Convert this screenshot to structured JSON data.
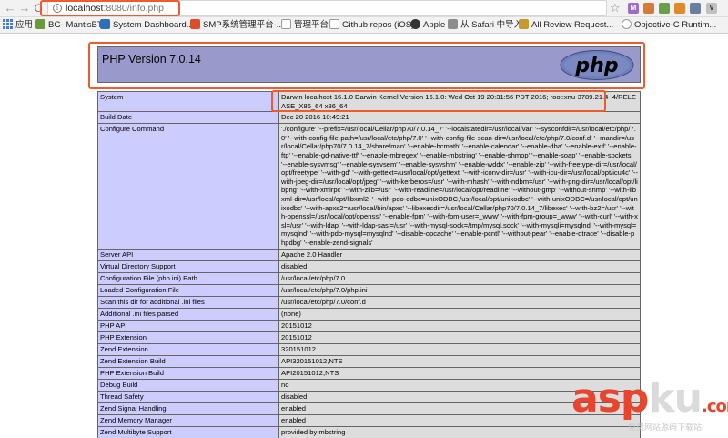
{
  "browser": {
    "url_host": "localhost",
    "url_path": ":8080/info.php",
    "nav": {
      "back": "←",
      "forward": "→",
      "reload": "C"
    },
    "extensions": [
      "M",
      "V"
    ]
  },
  "bookmarks": [
    {
      "label": "应用",
      "icon": "apps-grid-icon",
      "color": "#4a7bd4"
    },
    {
      "label": "BG- MantisBT",
      "icon": "mantis-icon",
      "color": "#6a9a3a"
    },
    {
      "label": "System Dashboard...",
      "icon": "jira-icon",
      "color": "#2f6fba"
    },
    {
      "label": "SMP系统管理平台-...",
      "icon": "smp-icon",
      "color": "#e24a2c"
    },
    {
      "label": "管理平台",
      "icon": "document-icon",
      "color": "#9a9a9a"
    },
    {
      "label": "Github repos (iOS)",
      "icon": "document-icon",
      "color": "#9a9a9a"
    },
    {
      "label": "Apple",
      "icon": "apple-icon",
      "color": "#333333"
    },
    {
      "label": "从 Safari 中导入",
      "icon": "folder-icon",
      "color": "#8d8d8d"
    },
    {
      "label": "All Review Request...",
      "icon": "review-icon",
      "color": "#c89a2c"
    },
    {
      "label": "Objective-C Runtim...",
      "icon": "globe-icon",
      "color": "#9a9a9a"
    }
  ],
  "php": {
    "title": "PHP Version 7.0.14",
    "logo_text": "php"
  },
  "info_rows": [
    {
      "key": "System",
      "value": "Darwin localhost 16.1.0 Darwin Kernel Version 16.1.0: Wed Oct 19 20:31:56 PDT 2016; root:xnu-3789.21.4~4/RELEASE_X86_64 x86_64"
    },
    {
      "key": "Build Date",
      "value": "Dec 20 2016 10:49:21"
    },
    {
      "key": "Configure Command",
      "value": "'./configure' '--prefix=/usr/local/Cellar/php70/7.0.14_7' '--localstatedir=/usr/local/var' '--sysconfdir=/usr/local/etc/php/7.0' '--with-config-file-path=/usr/local/etc/php/7.0' '--with-config-file-scan-dir=/usr/local/etc/php/7.0/conf.d' '--mandir=/usr/local/Cellar/php70/7.0.14_7/share/man' '--enable-bcmath' '--enable-calendar' '--enable-dba' '--enable-exif' '--enable-ftp' '--enable-gd-native-ttf' '--enable-mbregex' '--enable-mbstring' '--enable-shmop' '--enable-soap' '--enable-sockets' '--enable-sysvmsg' '--enable-sysvsem' '--enable-sysvshm' '--enable-wddx' '--enable-zip' '--with-freetype-dir=/usr/local/opt/freetype' '--with-gd' '--with-gettext=/usr/local/opt/gettext' '--with-iconv-dir=/usr' '--with-icu-dir=/usr/local/opt/icu4c' '--with-jpeg-dir=/usr/local/opt/jpeg' '--with-kerberos=/usr' '--with-mhash' '--with-ndbm=/usr' '--with-png-dir=/usr/local/opt/libpng' '--with-xmlrpc' '--with-zlib=/usr' '--with-readline=/usr/local/opt/readline' '--without-gmp' '--without-snmp' '--with-libxml-dir=/usr/local/opt/libxml2' '--with-pdo-odbc=unixODBC,/usr/local/opt/unixodbc' '--with-unixODBC=/usr/local/opt/unixodbc' '--with-apxs2=/usr/local/bin/apxs' '--libexecdir=/usr/local/Cellar/php70/7.0.14_7/libexec' '--with-bz2=/usr' '--with-openssl=/usr/local/opt/openssl' '--enable-fpm' '--with-fpm-user=_www' '--with-fpm-group=_www' '--with-curl' '--with-xsl=/usr' '--with-ldap' '--with-ldap-sasl=/usr' '--with-mysql-sock=/tmp/mysql.sock' '--with-mysqli=mysqlnd' '--with-mysql=mysqlnd' '--with-pdo-mysql=mysqlnd' '--disable-opcache' '--enable-pcntl' '--without-pear' '--enable-dtrace' '--disable-phpdbg' '--enable-zend-signals'"
    },
    {
      "key": "Server API",
      "value": "Apache 2.0 Handler"
    },
    {
      "key": "Virtual Directory Support",
      "value": "disabled"
    },
    {
      "key": "Configuration File (php.ini) Path",
      "value": "/usr/local/etc/php/7.0"
    },
    {
      "key": "Loaded Configuration File",
      "value": "/usr/local/etc/php/7.0/php.ini"
    },
    {
      "key": "Scan this dir for additional .ini files",
      "value": "/usr/local/etc/php/7.0/conf.d"
    },
    {
      "key": "Additional .ini files parsed",
      "value": "(none)"
    },
    {
      "key": "PHP API",
      "value": "20151012"
    },
    {
      "key": "PHP Extension",
      "value": "20151012"
    },
    {
      "key": "Zend Extension",
      "value": "320151012"
    },
    {
      "key": "Zend Extension Build",
      "value": "API320151012,NTS"
    },
    {
      "key": "PHP Extension Build",
      "value": "API20151012,NTS"
    },
    {
      "key": "Debug Build",
      "value": "no"
    },
    {
      "key": "Thread Safety",
      "value": "disabled"
    },
    {
      "key": "Zend Signal Handling",
      "value": "enabled"
    },
    {
      "key": "Zend Memory Manager",
      "value": "enabled"
    },
    {
      "key": "Zend Multibyte Support",
      "value": "provided by mbstring"
    }
  ],
  "watermark": {
    "part1": "asp",
    "part2": "ku",
    "part3": ".com",
    "subtitle": "免费网站源码下载站!"
  },
  "colors": {
    "highlight": "#ef5a2f",
    "php_header": "#9999cc",
    "key_cell": "#ccccff",
    "value_cell": "#dddddd"
  }
}
